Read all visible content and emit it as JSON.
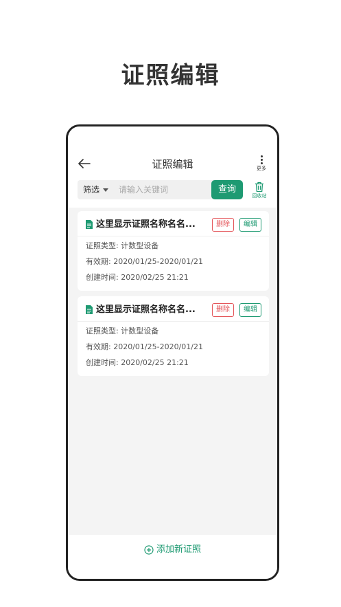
{
  "promo_title": "证照编辑",
  "nav": {
    "title": "证照编辑",
    "more_label": "更多"
  },
  "search": {
    "filter_label": "筛选",
    "placeholder": "请输入关键词",
    "value": "",
    "button_label": "查询",
    "recycle_label": "回收站"
  },
  "cards": [
    {
      "name": "这里显示证照名称名名...",
      "delete_label": "删除",
      "edit_label": "编辑",
      "type_line": "证照类型: 计数型设备",
      "validity_line": "有效期: 2020/01/25-2020/01/21",
      "created_line": "创建时间: 2020/02/25   21:21"
    },
    {
      "name": "这里显示证照名称名名...",
      "delete_label": "删除",
      "edit_label": "编辑",
      "type_line": "证照类型: 计数型设备",
      "validity_line": "有效期: 2020/01/25-2020/01/21",
      "created_line": "创建时间: 2020/02/25   21:21"
    }
  ],
  "add_button_label": "添加新证照",
  "colors": {
    "accent": "#1e9a72",
    "danger": "#e4565a",
    "background": "#f4f4f4"
  }
}
